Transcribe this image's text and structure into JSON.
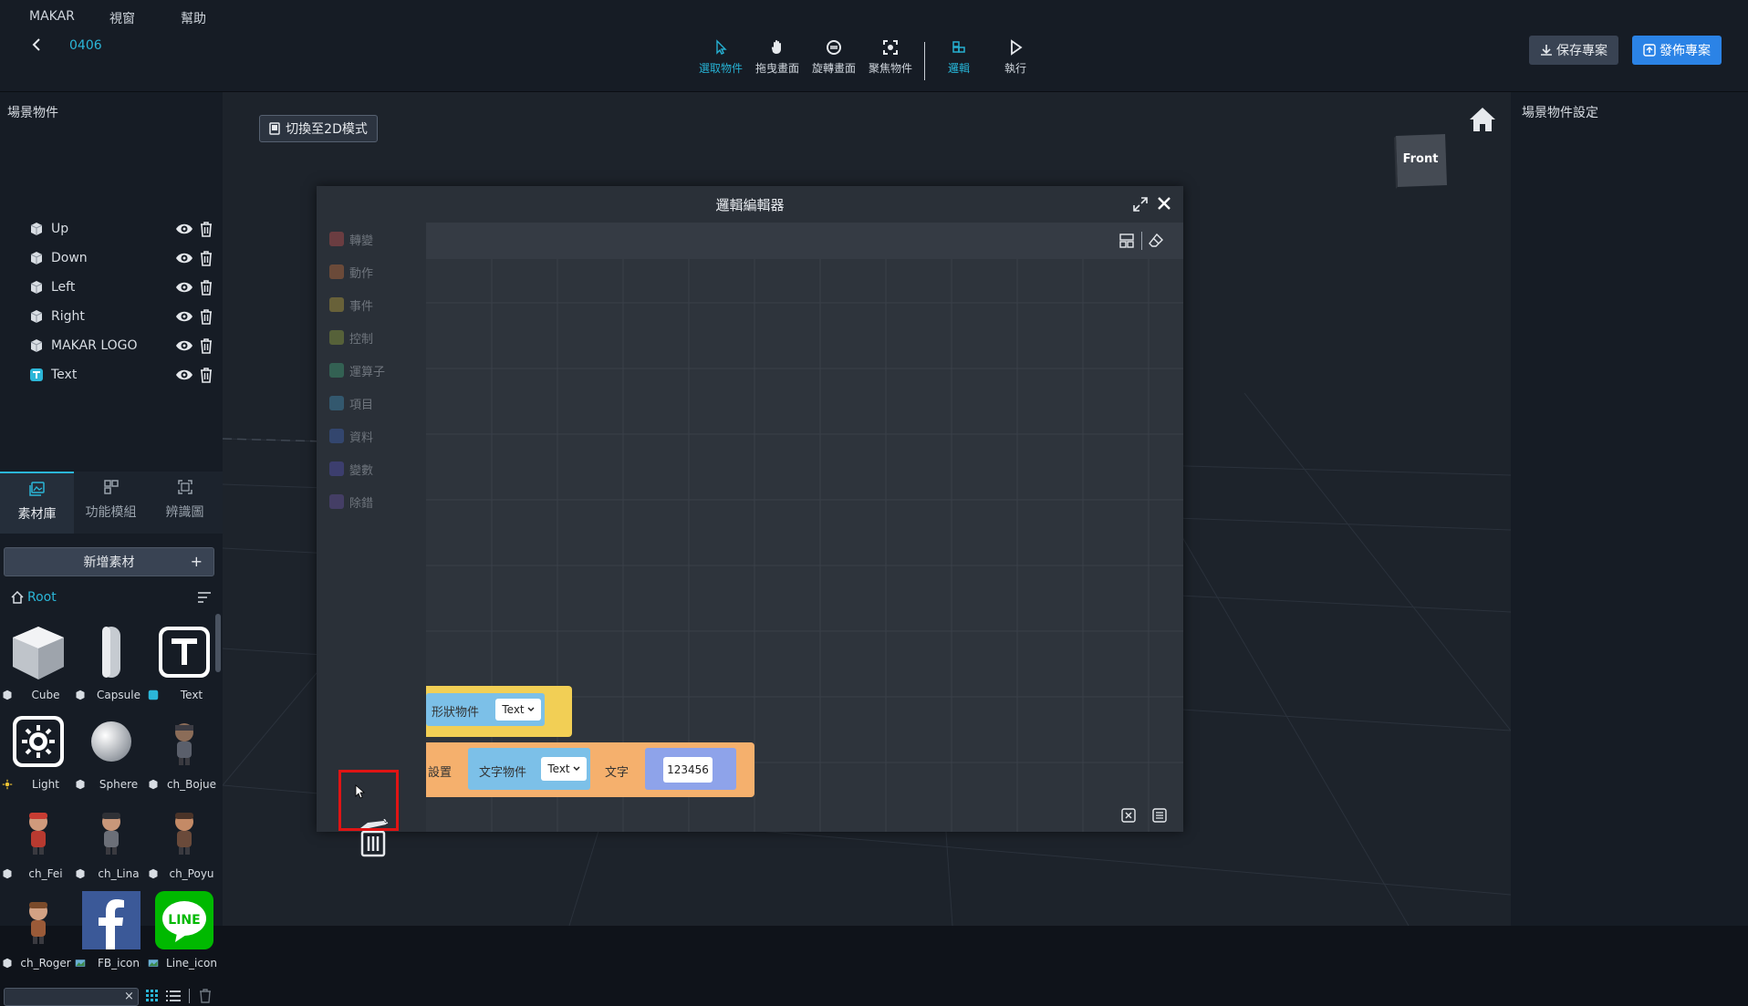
{
  "menu": {
    "items": [
      "MAKAR",
      "視窗",
      "幫助"
    ]
  },
  "project": {
    "name": "0406"
  },
  "toolbar": {
    "tools": [
      "選取物件",
      "拖曳畫面",
      "旋轉畫面",
      "聚焦物件",
      "邏輯",
      "執行"
    ],
    "save_label": "保存專案",
    "publish_label": "發佈專案",
    "accent": "#26b0d2"
  },
  "scene": {
    "title": "場景物件",
    "objects": [
      "Up",
      "Down",
      "Left",
      "Right",
      "MAKAR LOGO",
      "Text"
    ]
  },
  "assets": {
    "tabs": [
      "素材庫",
      "功能模組",
      "辨識圖"
    ],
    "add_label": "新增素材",
    "add_plus": "+",
    "root_label": "Root",
    "items": [
      "Cube",
      "Capsule",
      "Text",
      "Light",
      "Sphere",
      "ch_Bojue",
      "ch_Fei",
      "ch_Lina",
      "ch_Poyu",
      "ch_Roger",
      "FB_icon",
      "Line_icon"
    ],
    "search_placeholder": "",
    "search_clear": "×"
  },
  "viewport": {
    "switch_2d_label": "切換至2D模式",
    "nav_cube_label": "Front"
  },
  "logic_editor": {
    "title": "邏輯編輯器",
    "categories": [
      "轉變",
      "動作",
      "事件",
      "控制",
      "運算子",
      "項目",
      "資料",
      "變數",
      "除錯"
    ],
    "block_shape_label": "形狀物件",
    "block_shape_value": "Text",
    "block_set_label": "設置",
    "block_text_obj_label": "文字物件",
    "block_text_obj_value": "Text",
    "block_text_label": "文字",
    "block_text_value": "123456"
  },
  "right_panel": {
    "title": "場景物件設定"
  }
}
